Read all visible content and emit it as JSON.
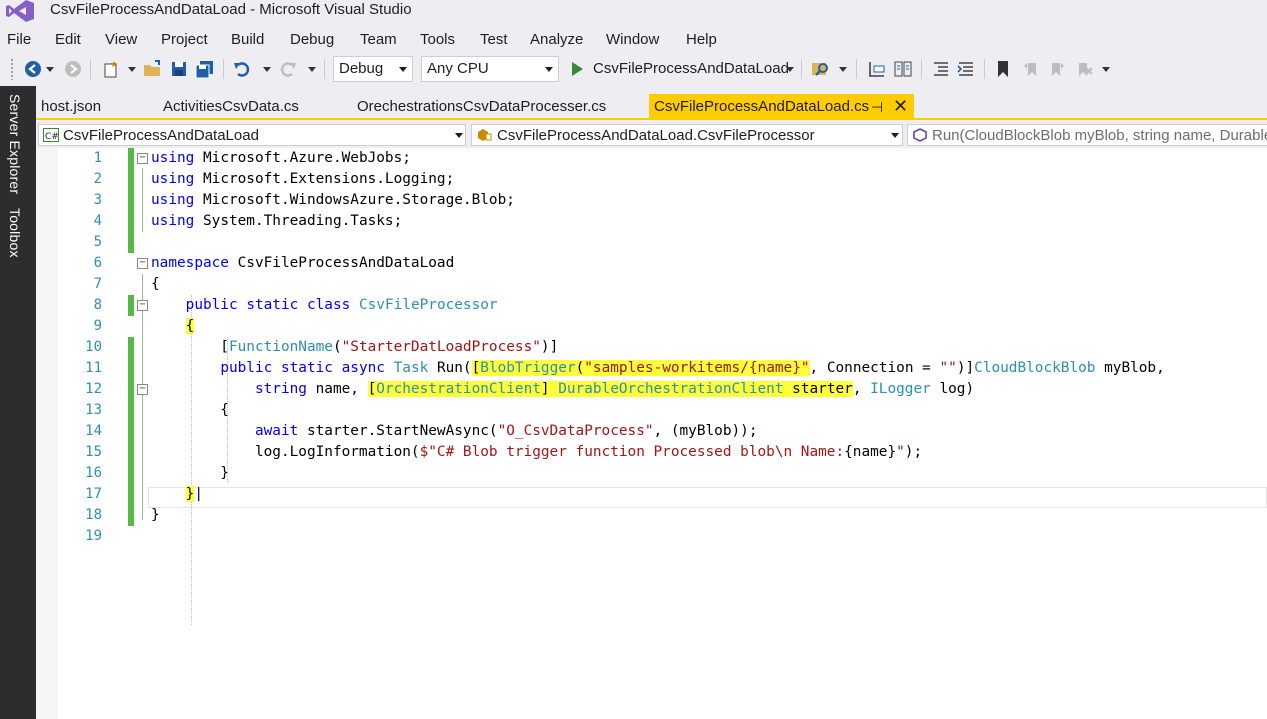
{
  "window": {
    "title": "CsvFileProcessAndDataLoad - Microsoft Visual Studio"
  },
  "menu": [
    "File",
    "Edit",
    "View",
    "Project",
    "Build",
    "Debug",
    "Team",
    "Tools",
    "Test",
    "Analyze",
    "Window",
    "Help"
  ],
  "toolbar": {
    "config": "Debug",
    "platform": "Any CPU",
    "start_target": "CsvFileProcessAndDataLoad"
  },
  "sidebar": {
    "items": [
      "Server Explorer",
      "Toolbox"
    ]
  },
  "tabs": [
    {
      "label": "host.json",
      "active": false
    },
    {
      "label": "ActivitiesCsvData.cs",
      "active": false
    },
    {
      "label": "OrechestrationsCsvDataProcesser.cs",
      "active": false
    },
    {
      "label": "CsvFileProcessAndDataLoad.cs",
      "active": true
    }
  ],
  "navbar": {
    "project": "CsvFileProcessAndDataLoad",
    "class": "CsvFileProcessAndDataLoad.CsvFileProcessor",
    "member": "Run(CloudBlockBlob myBlob, string name, Durable"
  },
  "editor": {
    "line_numbers": [
      "1",
      "2",
      "3",
      "4",
      "5",
      "6",
      "7",
      "8",
      "9",
      "10",
      "11",
      "12",
      "13",
      "14",
      "15",
      "16",
      "17",
      "18",
      "19"
    ],
    "lines": [
      "using Microsoft.Azure.WebJobs;",
      "using Microsoft.Extensions.Logging;",
      "using Microsoft.WindowsAzure.Storage.Blob;",
      "using System.Threading.Tasks;",
      "",
      "namespace CsvFileProcessAndDataLoad",
      "{",
      "    public static class CsvFileProcessor",
      "    {",
      "        [FunctionName(\"StarterDatLoadProcess\")]",
      "        public static async Task Run([BlobTrigger(\"samples-workitems/{name}\", Connection = \"\")]CloudBlockBlob myBlob,",
      "            string name, [OrchestrationClient] DurableOrchestrationClient starter, ILogger log)",
      "        {",
      "            await starter.StartNewAsync(\"O_CsvDataProcess\", (myBlob));",
      "            log.LogInformation($\"C# Blob trigger function Processed blob\\n Name:{name}\");",
      "        }",
      "    }",
      "}",
      ""
    ],
    "colors": {
      "keyword": "#0000ff",
      "type": "#2b91af",
      "string": "#a31515",
      "highlight": "#ffff3a",
      "change_bar": "#57b847"
    }
  },
  "icons": [
    "back-icon",
    "forward-icon",
    "new-project-icon",
    "open-folder-icon",
    "save-icon",
    "save-all-icon",
    "undo-icon",
    "redo-icon",
    "start-icon",
    "find-icon",
    "step-icon",
    "outline-icon",
    "bookmark-icon"
  ]
}
